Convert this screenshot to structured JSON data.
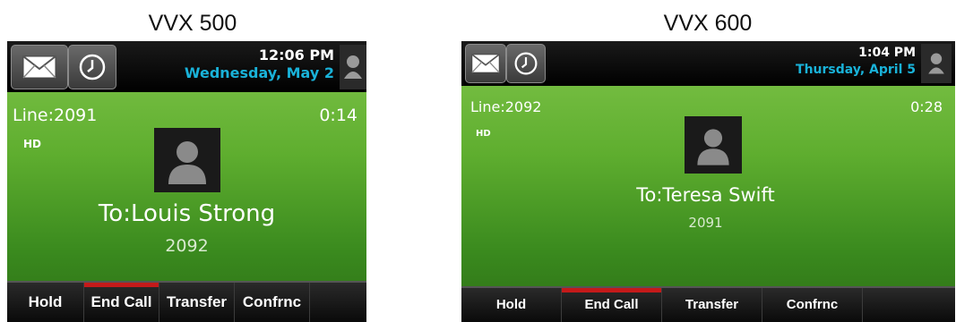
{
  "phones": [
    {
      "model": "VVX 500",
      "time": "12:06 PM",
      "date": "Wednesday, May 2",
      "line": "Line:2091",
      "duration": "0:14",
      "hd_label": "HD",
      "callee_name": "To:Louis Strong",
      "callee_number": "2092",
      "softkeys": [
        "Hold",
        "End Call",
        "Transfer",
        "Confrnc"
      ],
      "active_softkey": "End Call"
    },
    {
      "model": "VVX 600",
      "time": "1:04 PM",
      "date": "Thursday, April 5",
      "line": "Line:2092",
      "duration": "0:28",
      "hd_label": "HD",
      "callee_name": "To:Teresa Swift",
      "callee_number": "2091",
      "softkeys": [
        "Hold",
        "End Call",
        "Transfer",
        "Confrnc"
      ],
      "active_softkey": "End Call"
    }
  ],
  "icons": [
    "envelope-icon",
    "clock-icon",
    "person-icon"
  ],
  "colors": {
    "screen_green": "#5fae2f",
    "date_blue": "#19b2d9",
    "end_call_red": "#c41a1a"
  }
}
